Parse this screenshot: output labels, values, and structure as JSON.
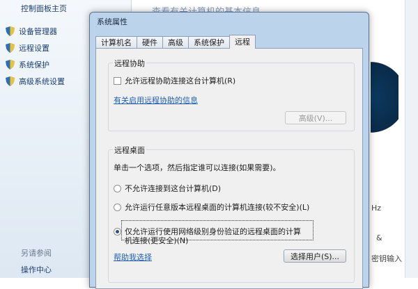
{
  "control_panel": {
    "home": "控制面板主页",
    "tasks": [
      "设备管理器",
      "远程设置",
      "系统保护",
      "高级系统设置"
    ],
    "see_also": "另请参阅",
    "action_center": "操作中心",
    "heading": "查看有关计算机的基本信息",
    "right_fragments": [
      "Hz",
      "&",
      "密钥输入"
    ]
  },
  "dialog": {
    "title": "系统属性",
    "tabs": [
      "计算机名",
      "硬件",
      "高级",
      "系统保护",
      "远程"
    ],
    "active_tab": "远程",
    "assistance": {
      "group_title": "远程协助",
      "allow_checkbox": "允许远程协助连接这台计算机(R)",
      "allow_checked": false,
      "info_link": "有关启用远程协助的信息",
      "advanced_button": "高级(V)..."
    },
    "desktop": {
      "group_title": "远程桌面",
      "instruction": "单击一个选项，然后指定谁可以连接(如果需要)。",
      "options": [
        "不允许连接到这台计算机(D)",
        "允许运行任意版本远程桌面的计算机连接(较不安全)(L)",
        "仅允许运行使用网络级别身份验证的远程桌面的计算",
        "机连接(更安全)(N)"
      ],
      "selected_option": 2,
      "help_link": "帮助我选择",
      "select_users_button": "选择用户(S)..."
    }
  }
}
